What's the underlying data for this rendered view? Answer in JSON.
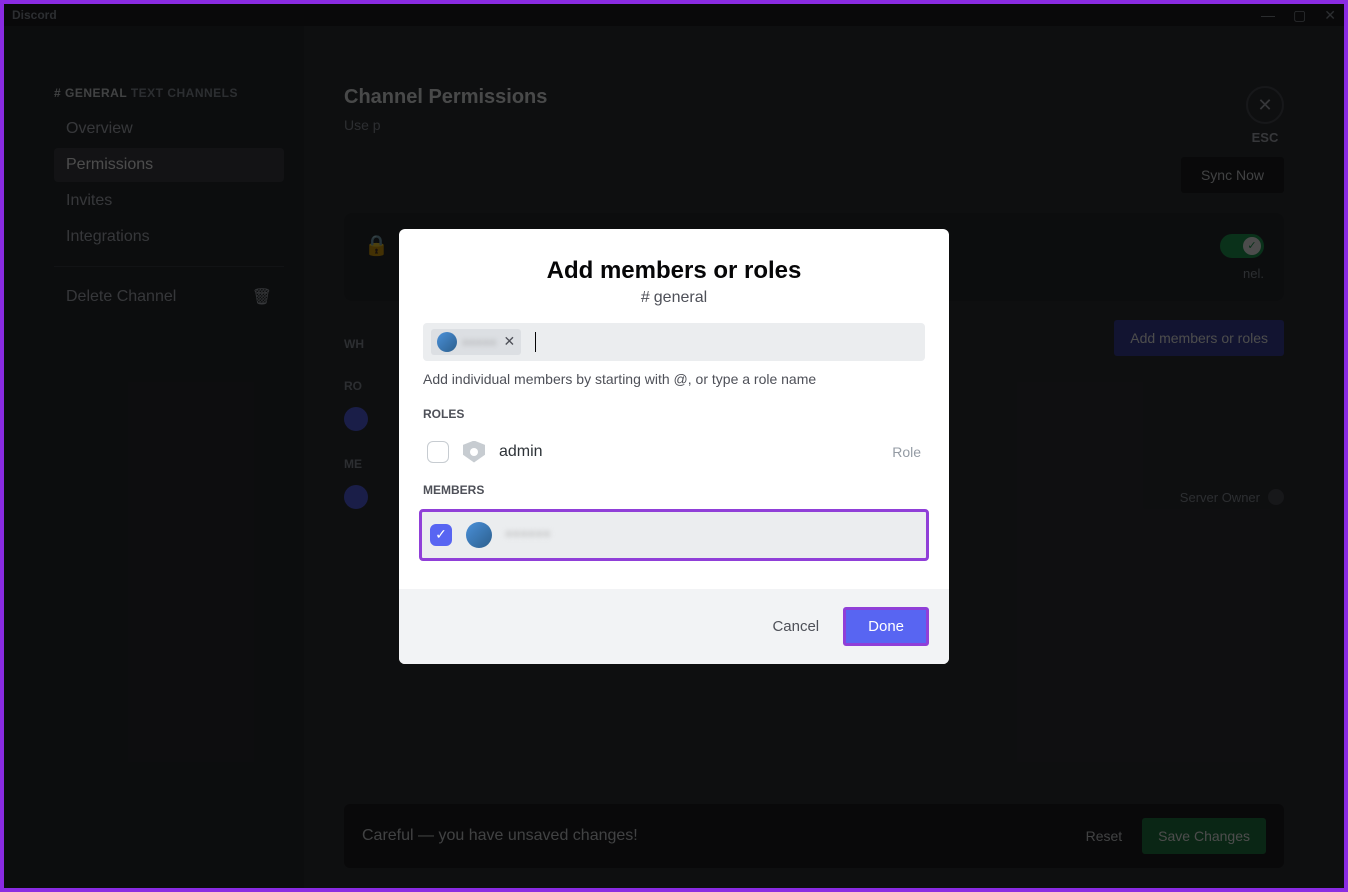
{
  "titlebar": {
    "app": "Discord"
  },
  "sidebar": {
    "channel_prefix": "# GENERAL",
    "channel_suffix": "TEXT CHANNELS",
    "items": [
      {
        "label": "Overview",
        "active": false
      },
      {
        "label": "Permissions",
        "active": true
      },
      {
        "label": "Invites",
        "active": false
      },
      {
        "label": "Integrations",
        "active": false
      }
    ],
    "delete_label": "Delete Channel"
  },
  "main": {
    "title": "Channel Permissions",
    "subtitle": "Use p",
    "close_label": "ESC",
    "sync_label": "Sync Now",
    "private_desc_end": "nel.",
    "section_who": "WH",
    "section_roles_bg": "RO",
    "section_members_bg": "ME",
    "add_button": "Add members or roles",
    "server_owner": "Server Owner"
  },
  "unsaved": {
    "text": "Careful — you have unsaved changes!",
    "reset": "Reset",
    "save": "Save Changes"
  },
  "modal": {
    "title": "Add members or roles",
    "channel": "general",
    "chip_name": "•••••",
    "hint": "Add individual members by starting with @, or type a role name",
    "roles_label": "ROLES",
    "members_label": "MEMBERS",
    "roles": [
      {
        "name": "admin",
        "tag": "Role",
        "checked": false
      }
    ],
    "members": [
      {
        "name": "••••••",
        "checked": true,
        "highlighted": true
      }
    ],
    "cancel": "Cancel",
    "done": "Done"
  }
}
